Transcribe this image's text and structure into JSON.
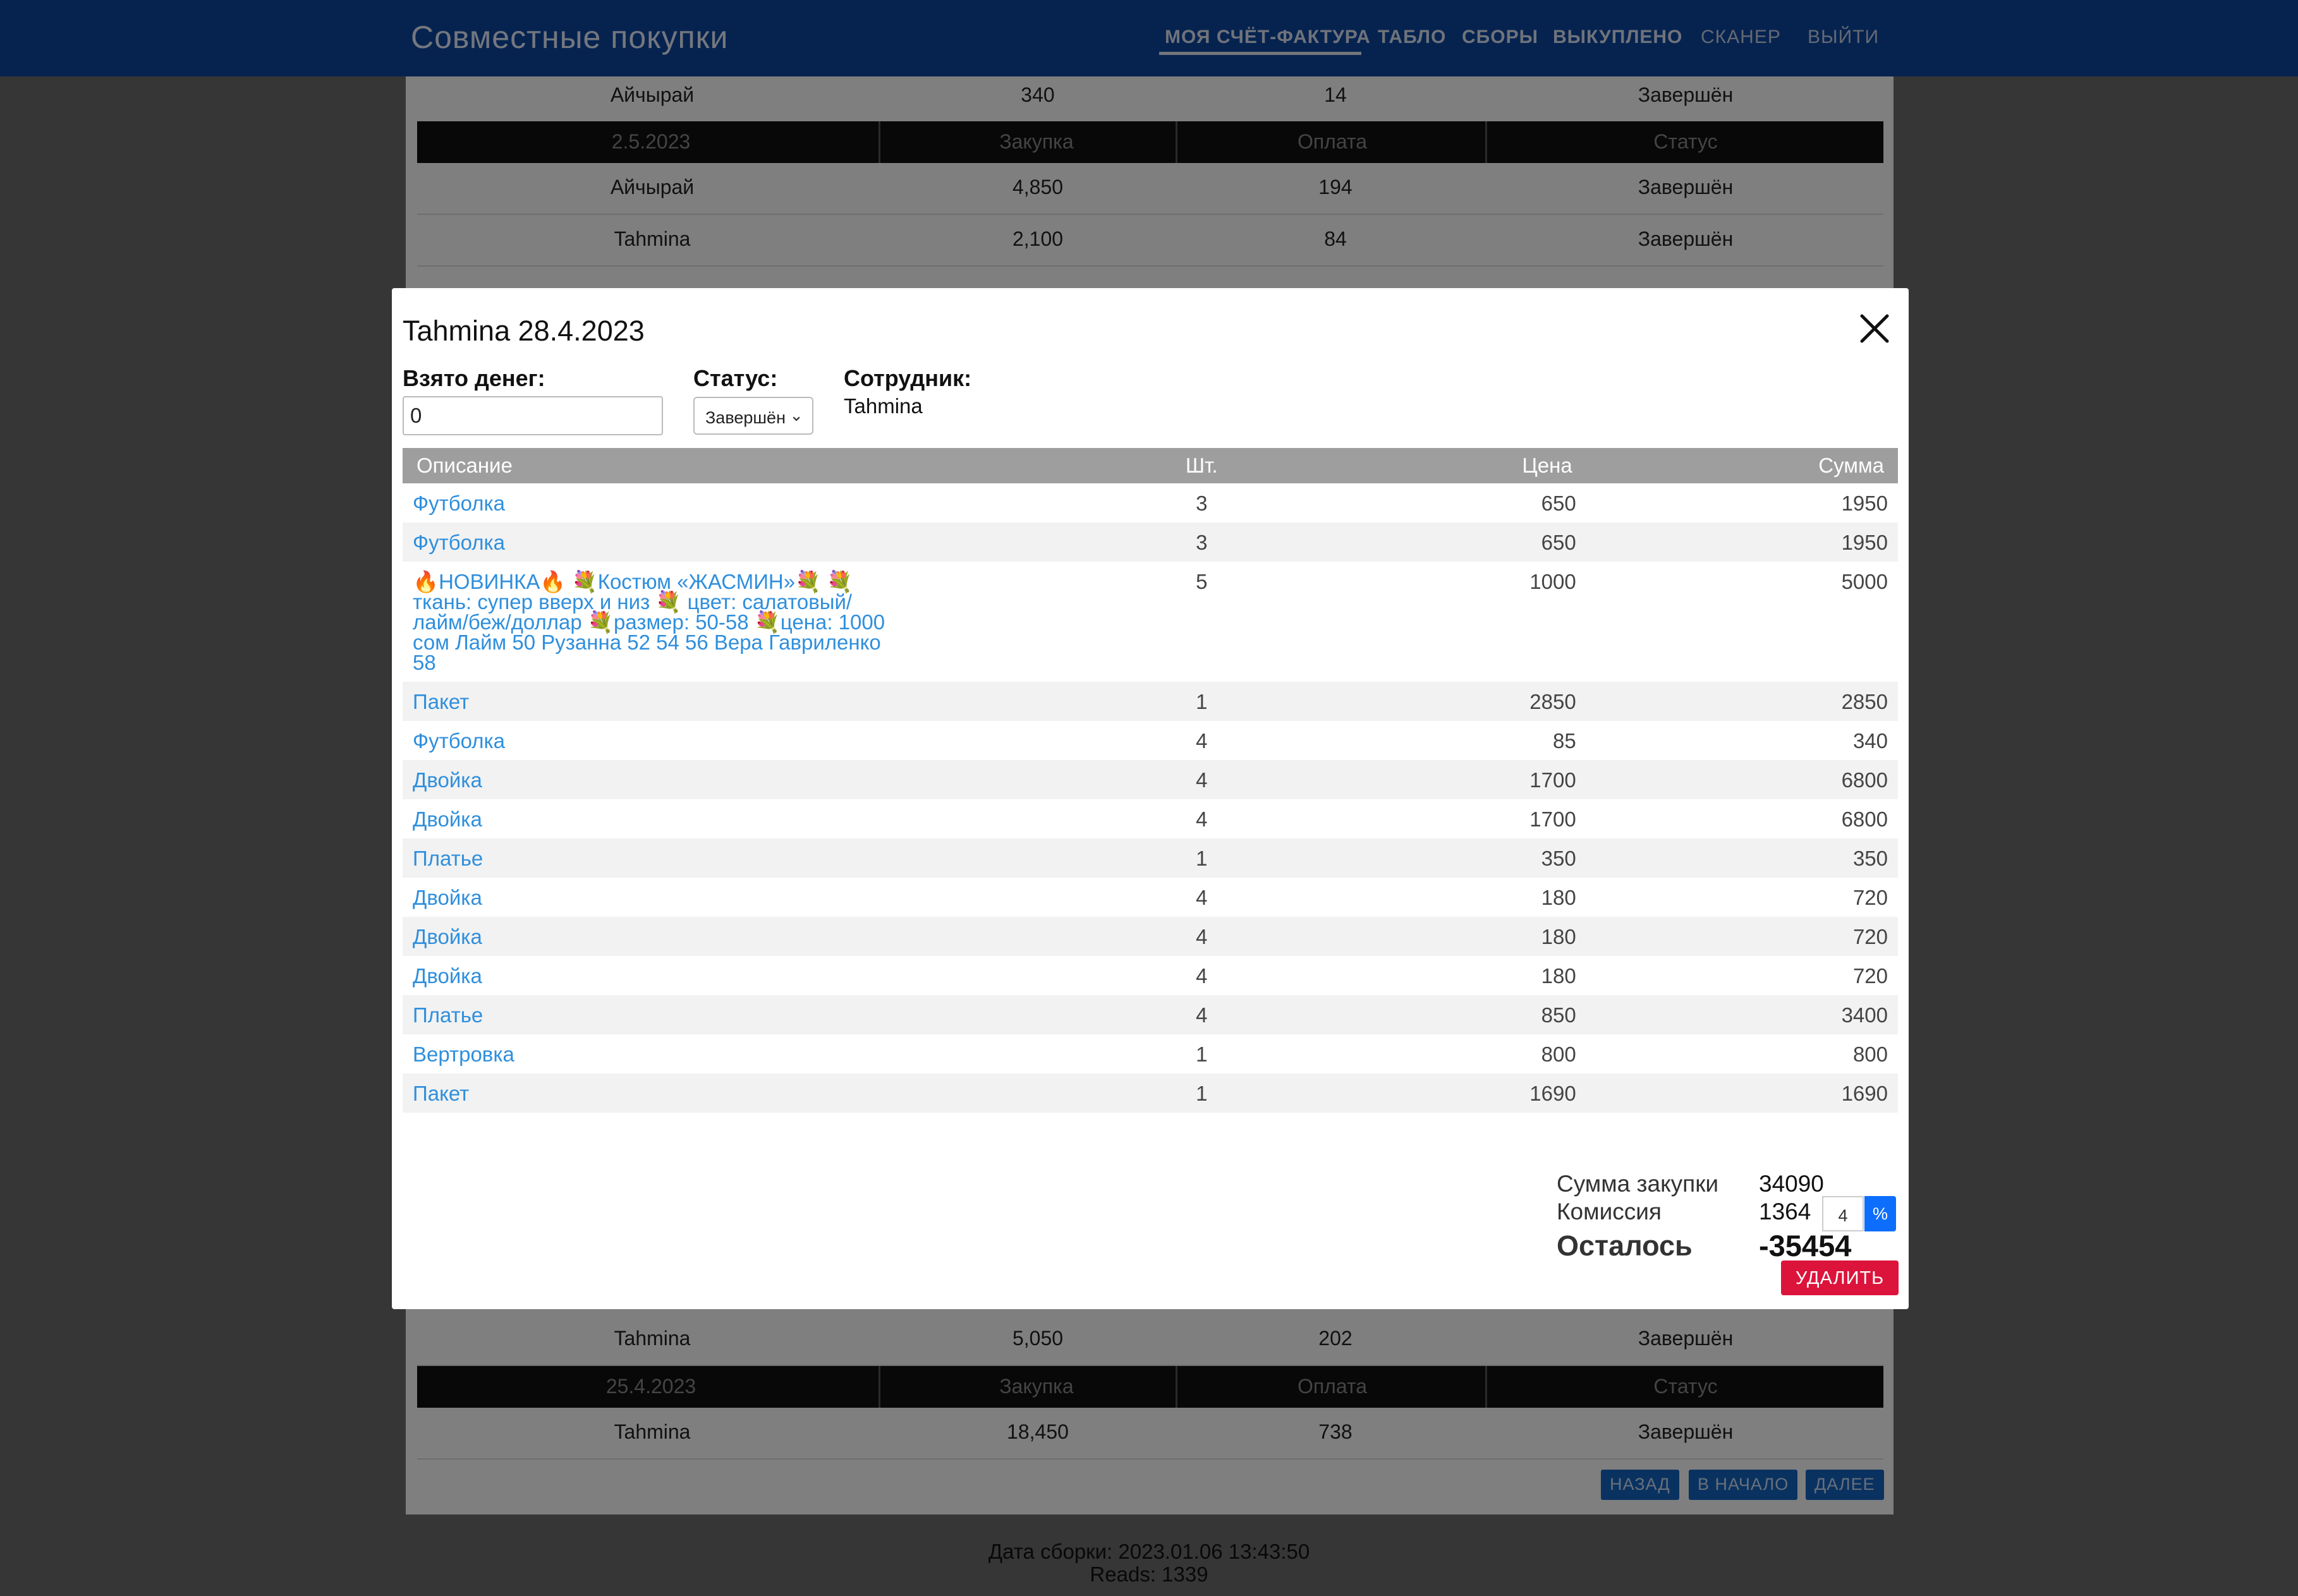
{
  "navbar": {
    "brand": "Совместные покупки",
    "items": [
      "МОЯ СЧЁТ-ФАКТУРА",
      "ТАБЛО",
      "СБОРЫ",
      "ВЫКУПЛЕНО",
      "СКАНЕР",
      "ВЫЙТИ"
    ]
  },
  "background_table": {
    "rows_top": [
      {
        "name": "Айчырай",
        "purchase": "340",
        "payment": "14",
        "status": "Завершён"
      }
    ],
    "group1": {
      "header": {
        "date": "2.5.2023",
        "purchase": "Закупка",
        "payment": "Оплата",
        "status": "Статус"
      },
      "rows": [
        {
          "name": "Айчырай",
          "purchase": "4,850",
          "payment": "194",
          "status": "Завершён"
        },
        {
          "name": "Tahmina",
          "purchase": "2,100",
          "payment": "84",
          "status": "Завершён"
        }
      ]
    },
    "row_before_group2": {
      "name": "Tahmina",
      "purchase": "5,050",
      "payment": "202",
      "status": "Завершён"
    },
    "group2": {
      "header": {
        "date": "25.4.2023",
        "purchase": "Закупка",
        "payment": "Оплата",
        "status": "Статус"
      },
      "rows": [
        {
          "name": "Tahmina",
          "purchase": "18,450",
          "payment": "738",
          "status": "Завершён"
        }
      ]
    },
    "pager": {
      "back": "НАЗАД",
      "start": "В НАЧАЛО",
      "next": "ДАЛЕЕ"
    }
  },
  "footer": {
    "build_date": "Дата сборки: 2023.01.06 13:43:50",
    "reads": "Reads: 1339"
  },
  "modal": {
    "title": "Tahmina 28.4.2023",
    "money_label": "Взято денег:",
    "money_value": "0",
    "status_label": "Статус:",
    "status_value": "Завершён",
    "employee_label": "Сотрудник:",
    "employee_name": "Tahmina",
    "table": {
      "headers": {
        "desc": "Описание",
        "qty": "Шт.",
        "price": "Цена",
        "sum": "Сумма"
      },
      "rows": [
        {
          "desc": "Футболка",
          "qty": "3",
          "price": "650",
          "sum": "1950"
        },
        {
          "desc": "Футболка",
          "qty": "3",
          "price": "650",
          "sum": "1950"
        },
        {
          "desc": "🔥НОВИНКА🔥 💐Костюм «ЖАСМИН»💐 💐ткань: супер вверх и низ 💐 цвет: салатовый/лайм/беж/доллар 💐размер: 50-58 💐цена: 1000 сом Лайм 50 Рузанна 52 54 56 Вера Гавриленко 58",
          "qty": "5",
          "price": "1000",
          "sum": "5000"
        },
        {
          "desc": "Пакет",
          "qty": "1",
          "price": "2850",
          "sum": "2850"
        },
        {
          "desc": "Футболка",
          "qty": "4",
          "price": "85",
          "sum": "340"
        },
        {
          "desc": "Двойка",
          "qty": "4",
          "price": "1700",
          "sum": "6800"
        },
        {
          "desc": "Двойка",
          "qty": "4",
          "price": "1700",
          "sum": "6800"
        },
        {
          "desc": "Платье",
          "qty": "1",
          "price": "350",
          "sum": "350"
        },
        {
          "desc": "Двойка",
          "qty": "4",
          "price": "180",
          "sum": "720"
        },
        {
          "desc": "Двойка",
          "qty": "4",
          "price": "180",
          "sum": "720"
        },
        {
          "desc": "Двойка",
          "qty": "4",
          "price": "180",
          "sum": "720"
        },
        {
          "desc": "Платье",
          "qty": "4",
          "price": "850",
          "sum": "3400"
        },
        {
          "desc": "Вертровка",
          "qty": "1",
          "price": "800",
          "sum": "800"
        },
        {
          "desc": "Пакет",
          "qty": "1",
          "price": "1690",
          "sum": "1690"
        }
      ]
    },
    "summary": {
      "purchase_label": "Сумма закупки",
      "purchase_value": "34090",
      "commission_label": "Комиссия",
      "commission_value": "1364",
      "commission_percent": "4",
      "percent_symbol": "%",
      "remaining_label": "Осталось",
      "remaining_value": "-35454"
    },
    "delete_label": "УДАЛИТЬ"
  },
  "colors": {
    "navbar": "#0d47a1",
    "link": "#2f8fdd",
    "table_header": "#9e9e9e",
    "delete_button": "#dc143c",
    "percent_button": "#0d6efd"
  }
}
